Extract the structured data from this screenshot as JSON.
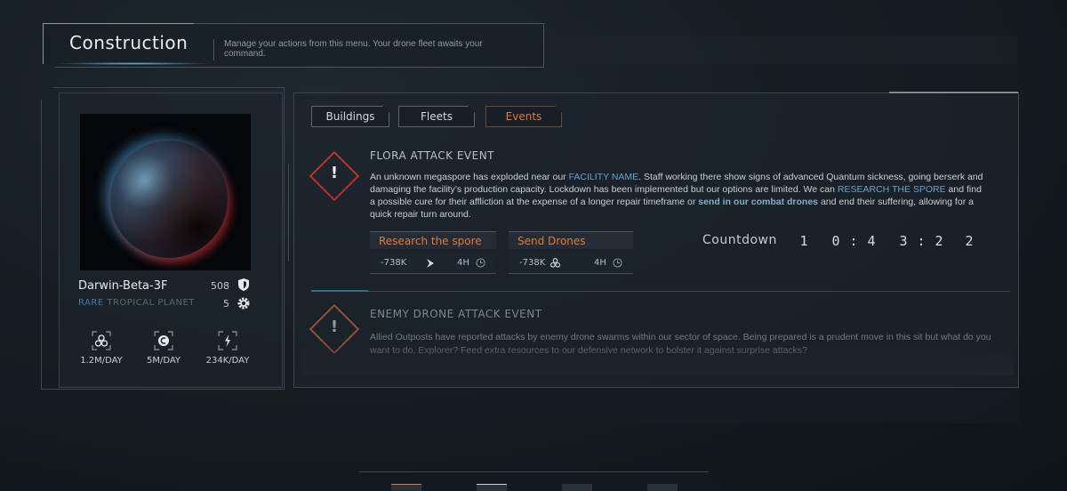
{
  "header": {
    "title": "Construction",
    "description": "Manage your actions from this menu. Your drone fleet awaits your command."
  },
  "planet": {
    "name": "Darwin-Beta-3F",
    "rarity": "RARE",
    "type": "TROPICAL PLANET",
    "defense": "508",
    "level": "5",
    "resources": [
      {
        "icon": "drone-icon",
        "rate": "1.2M/DAY"
      },
      {
        "icon": "credit-icon",
        "rate": "5M/DAY"
      },
      {
        "icon": "energy-icon",
        "rate": "234K/DAY"
      }
    ]
  },
  "tabs": [
    {
      "label": "Buildings",
      "active": false
    },
    {
      "label": "Fleets",
      "active": false
    },
    {
      "label": "Events",
      "active": true
    }
  ],
  "event1": {
    "title": "FLORA ATTACK EVENT",
    "text_a": "An unknown megaspore has exploded near our ",
    "facility": "FACILITY NAME",
    "text_b": ". Staff working there show signs of advanced Quantum sickness, going berserk and damaging the facility’s production capacity. Lockdown has been implemented but our options are limited. We can ",
    "research": "RESEARCH THE SPORE",
    "text_c": " and find a possible cure for their affliction at the expense of a longer repair timeframe or ",
    "drones": "send in our combat drones",
    "text_d": " and end their suffering, allowing for a quick repair turn around.",
    "actions": [
      {
        "label": "Research the spore",
        "cost": "-738K",
        "cost_icon": "energy-icon",
        "time": "4H"
      },
      {
        "label": "Send Drones",
        "cost": "-738K",
        "cost_icon": "drone-icon",
        "time": "4H"
      }
    ],
    "countdown_label": "Countdown",
    "countdown_digits": [
      "1",
      "0",
      ":",
      "4",
      "3",
      ":",
      "2",
      "2"
    ]
  },
  "event2": {
    "title": "ENEMY DRONE ATTACK EVENT",
    "text": "Allied Outposts have reported attacks by enemy drone swarms within our sector of space. Being prepared is a prudent move in this sit but what do you want to do, Explorer? Feed extra resources to our defensive network to bolster it against surprise attacks?"
  },
  "colors": {
    "accent_orange": "#e07a3a",
    "warning_red": "#c0302e",
    "highlight_blue": "#6aa3c4",
    "rare_blue": "#3f7ea6"
  }
}
